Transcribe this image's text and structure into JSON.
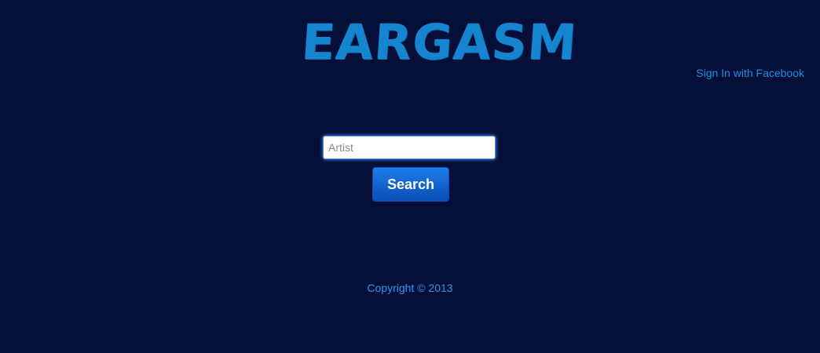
{
  "header": {
    "logo_text": "EARGASM",
    "sign_in_link": "Sign In with Facebook"
  },
  "search": {
    "placeholder": "Artist",
    "value": "",
    "button_label": "Search"
  },
  "footer": {
    "copyright": "Copyright © 2013"
  },
  "colors": {
    "background": "#060f37",
    "logo": "#1585d0",
    "link": "#1a8fe3",
    "button": "#1267d6"
  }
}
